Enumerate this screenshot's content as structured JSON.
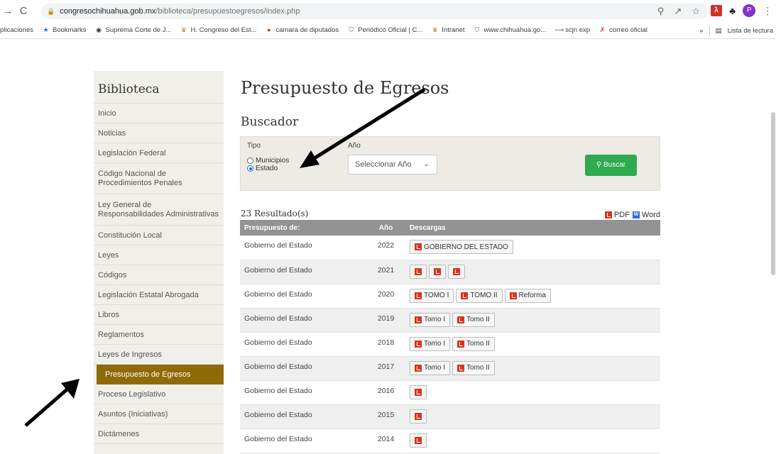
{
  "browser": {
    "url_host": "congresochihuahua.gob.mx",
    "url_path": "/biblioteca/presupuestoegresos/index.php",
    "profile_initial": "P",
    "bookmarks": [
      {
        "label": "plicaciones",
        "icon": "apps-icon"
      },
      {
        "label": "Bookmarks",
        "icon": "star-icon"
      },
      {
        "label": "Suprema Corte de J...",
        "icon": "globe-icon"
      },
      {
        "label": "H. Congreso del Est...",
        "icon": "congress-icon"
      },
      {
        "label": "camara de diputados",
        "icon": "camara-icon"
      },
      {
        "label": "Periódico Oficial | C...",
        "icon": "shield-icon"
      },
      {
        "label": "Intranet",
        "icon": "congress-icon"
      },
      {
        "label": "www.chihuahua.go...",
        "icon": "shield-icon"
      },
      {
        "label": "scjn exp",
        "icon": "scjn-icon"
      },
      {
        "label": "correo oficial",
        "icon": "x-icon"
      }
    ],
    "more": "»",
    "reading_list": "Lista de lectura"
  },
  "sidebar": {
    "title": "Biblioteca",
    "items": [
      {
        "label": "Inicio"
      },
      {
        "label": "Noticias"
      },
      {
        "label": "Legislación Federal"
      },
      {
        "label": "Código Nacional de Procedimientos Penales"
      },
      {
        "label": "Ley General de Responsabilidades Administrativas"
      },
      {
        "label": "Constitución Local"
      },
      {
        "label": "Leyes"
      },
      {
        "label": "Códigos"
      },
      {
        "label": "Legislación Estatal Abrogada"
      },
      {
        "label": "Libros"
      },
      {
        "label": "Reglamentos"
      },
      {
        "label": "Leyes de Ingresos"
      },
      {
        "label": "Presupuesto de Egresos"
      },
      {
        "label": "Proceso Legislativo"
      },
      {
        "label": "Asuntos (Iniciativas)"
      },
      {
        "label": "Dictámenes"
      }
    ]
  },
  "main": {
    "title": "Presupuesto de Egresos",
    "search_title": "Buscador",
    "tipo_label": "Tipo",
    "anio_label": "Año",
    "radio_municipios": "Municipios",
    "radio_estado": "Estado",
    "select_value": "Seleccionar Año",
    "buscar_label": "Buscar",
    "results_count": "23 Resultado(s)",
    "export_pdf": "PDF",
    "export_word": "Word",
    "columns": [
      "Presupuesto de:",
      "Año",
      "Descargas"
    ],
    "rows": [
      {
        "entity": "Gobierno del Estado",
        "year": "2022",
        "downloads": [
          "GOBIERNO DEL ESTADO"
        ]
      },
      {
        "entity": "Gobierno del Estado",
        "year": "2021",
        "downloads": [
          "",
          "",
          ""
        ]
      },
      {
        "entity": "Gobierno del Estado",
        "year": "2020",
        "downloads": [
          "TOMO I",
          "TOMO II",
          "Reforma"
        ]
      },
      {
        "entity": "Gobierno del Estado",
        "year": "2019",
        "downloads": [
          "Tomo I",
          "Tomo II"
        ]
      },
      {
        "entity": "Gobierno del Estado",
        "year": "2018",
        "downloads": [
          "Tomo I",
          "Tomo II"
        ]
      },
      {
        "entity": "Gobierno del Estado",
        "year": "2017",
        "downloads": [
          "Tomo I",
          "Tomo II"
        ]
      },
      {
        "entity": "Gobierno del Estado",
        "year": "2016",
        "downloads": [
          ""
        ]
      },
      {
        "entity": "Gobierno del Estado",
        "year": "2015",
        "downloads": [
          ""
        ]
      },
      {
        "entity": "Gobierno del Estado",
        "year": "2014",
        "downloads": [
          ""
        ]
      }
    ]
  },
  "colors": {
    "active_item": "#8e6b06",
    "buscar_button": "#2eaa4f",
    "pdf_red": "#d9341c",
    "table_header": "#939393"
  }
}
